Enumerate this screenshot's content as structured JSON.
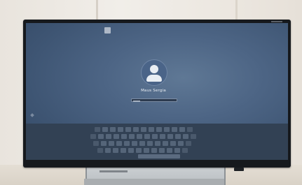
{
  "scene": {
    "description_type": "photo-of-touchscreen",
    "colors": {
      "wall": "#efebe5",
      "bezel": "#16191d",
      "screen_blue": "#4d6585",
      "keyboard": "#324154"
    }
  },
  "login_screen": {
    "user_name": "Maus Sergia",
    "avatar_icon": "user-avatar-icon",
    "pin_field_placeholder": ""
  },
  "on_screen_keyboard": {
    "visible": true,
    "rows": 4
  }
}
